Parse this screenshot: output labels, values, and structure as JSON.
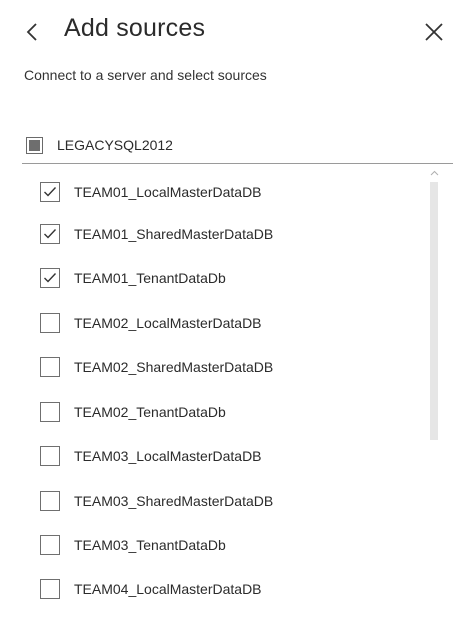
{
  "header": {
    "title": "Add sources",
    "back_icon": "chevron-left-icon",
    "close_icon": "close-icon"
  },
  "subtitle": "Connect to a server and select sources",
  "server": {
    "name": "LEGACYSQL2012",
    "state": "partial"
  },
  "databases": [
    {
      "label": "TEAM01_LocalMasterDataDB",
      "checked": true
    },
    {
      "label": "TEAM01_SharedMasterDataDB",
      "checked": true
    },
    {
      "label": "TEAM01_TenantDataDb",
      "checked": true
    },
    {
      "label": "TEAM02_LocalMasterDataDB",
      "checked": false
    },
    {
      "label": "TEAM02_SharedMasterDataDB",
      "checked": false
    },
    {
      "label": "TEAM02_TenantDataDb",
      "checked": false
    },
    {
      "label": "TEAM03_LocalMasterDataDB",
      "checked": false
    },
    {
      "label": "TEAM03_SharedMasterDataDB",
      "checked": false
    },
    {
      "label": "TEAM03_TenantDataDb",
      "checked": false
    },
    {
      "label": "TEAM04_LocalMasterDataDB",
      "checked": false
    }
  ],
  "colors": {
    "text": "#2b2b2b",
    "checkbox_border": "#6f6f6f",
    "divider": "#9a9a9a",
    "scroll_thumb": "#e6e6e6"
  }
}
